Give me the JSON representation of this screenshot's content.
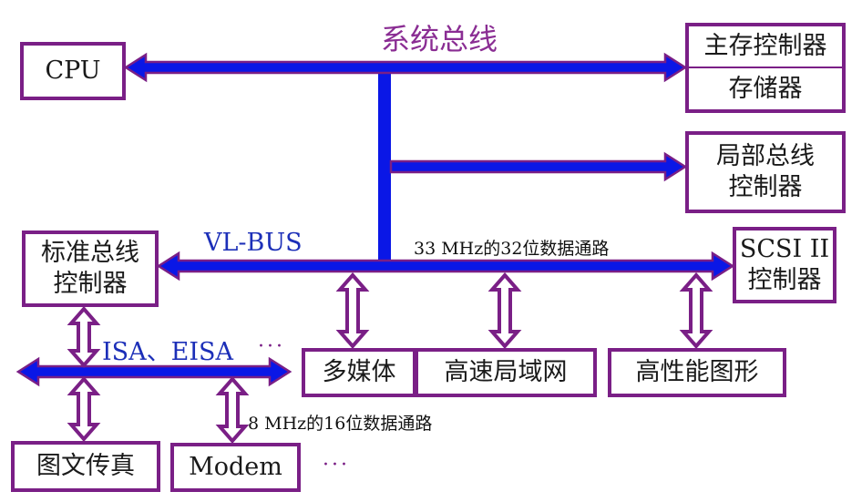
{
  "diagram": {
    "title": "系统总线",
    "colors": {
      "box_border": "#7a1f86",
      "bus_fill": "#0a17e6",
      "bus_edge": "#7a1f86",
      "bus_label": "#1c2fb8",
      "title": "#8a2d93"
    },
    "boxes": {
      "cpu": "CPU",
      "main_memory_controller": "主存控制器",
      "memory": "存储器",
      "local_bus_controller": [
        "局部总线",
        "控制器"
      ],
      "standard_bus_controller": [
        "标准总线",
        "控制器"
      ],
      "scsi_controller": [
        "SCSI II",
        "控制器"
      ],
      "multimedia": "多媒体",
      "high_speed_lan": "高速局域网",
      "high_perf_graphics": "高性能图形",
      "fax": "图文传真",
      "modem": "Modem"
    },
    "labels": {
      "vl_bus": "VL-BUS",
      "vl_bus_spec": "33 MHz的32位数据通路",
      "isa_bus": "ISA、EISA",
      "isa_ellipsis": "···",
      "isa_bus_spec": "8 MHz的16位数据通路",
      "more_devices": "···"
    }
  }
}
